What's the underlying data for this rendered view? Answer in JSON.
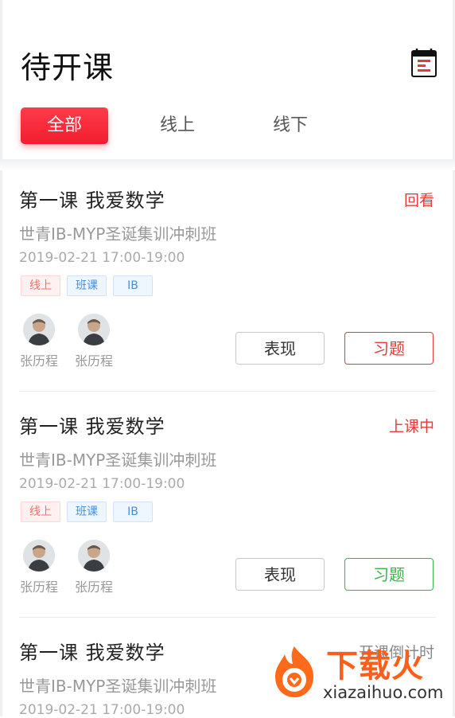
{
  "header": {
    "title": "待开课",
    "calendar_icon": "calendar-icon"
  },
  "tabs": [
    {
      "label": "全部",
      "active": true
    },
    {
      "label": "线上",
      "active": false
    },
    {
      "label": "线下",
      "active": false
    }
  ],
  "colors": {
    "accent": "#f01e2e",
    "status_red": "#e83a3a",
    "green": "#3bb54a",
    "tag_blue": "#4a90d9"
  },
  "courses": [
    {
      "title": "第一课  我爱数学",
      "status": "回看",
      "subtitle": "世青IB-MYP圣诞集训冲刺班",
      "time": "2019-02-21 17:00-19:00",
      "tags": [
        "线上",
        "班课",
        "IB"
      ],
      "teachers": [
        "张历程",
        "张历程"
      ],
      "buttons": {
        "show": "表现",
        "homework": "习题"
      }
    },
    {
      "title": "第一课  我爱数学",
      "status": "上课中",
      "subtitle": "世青IB-MYP圣诞集训冲刺班",
      "time": "2019-02-21 17:00-19:00",
      "tags": [
        "线上",
        "班课",
        "IB"
      ],
      "teachers": [
        "张历程",
        "张历程"
      ],
      "buttons": {
        "show": "表现",
        "homework": "习题"
      }
    },
    {
      "title": "第一课  我爱数学",
      "status": "开课倒计时",
      "subtitle": "世青IB-MYP圣诞集训冲刺班",
      "time": "2019-02-21 17:00-19:00"
    }
  ],
  "watermark": {
    "text": "下载火",
    "url": "xiazaihuo.com"
  }
}
